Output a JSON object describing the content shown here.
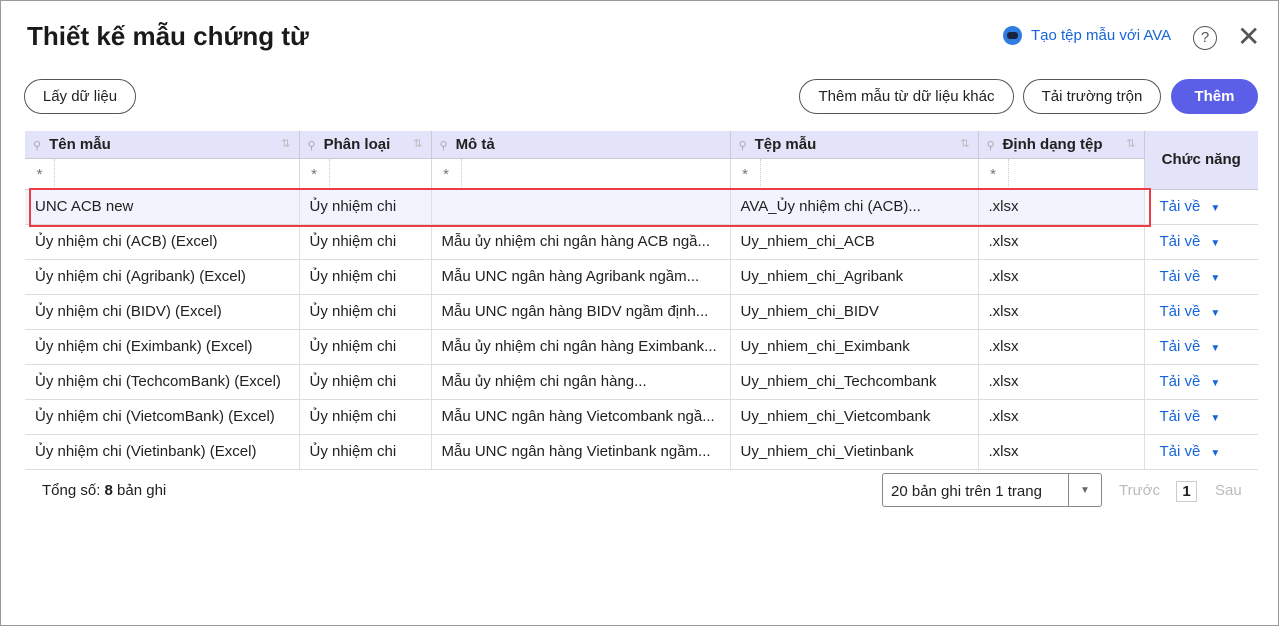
{
  "header": {
    "title": "Thiết kế mẫu chứng từ",
    "ava_link": "Tạo tệp mẫu với AVA",
    "help": "?",
    "close": "✕"
  },
  "toolbar": {
    "get_data": "Lấy dữ liệu",
    "add_from_other": "Thêm mẫu từ dữ liệu khác",
    "download_fields": "Tải trường trộn",
    "add": "Thêm"
  },
  "table": {
    "columns": [
      "Tên mẫu",
      "Phân loại",
      "Mô tả",
      "Tệp mẫu",
      "Định dạng tệp"
    ],
    "action_column": "Chức năng",
    "filter_symbol": "*",
    "action_label": "Tải về",
    "rows": [
      [
        "UNC ACB new",
        "Ủy nhiệm chi",
        "",
        "AVA_Ủy nhiệm chi (ACB)...",
        ".xlsx"
      ],
      [
        "Ủy nhiệm chi (ACB) (Excel)",
        "Ủy nhiệm chi",
        "Mẫu ủy nhiệm chi ngân hàng ACB ngầ...",
        "Uy_nhiem_chi_ACB",
        ".xlsx"
      ],
      [
        "Ủy nhiệm chi (Agribank) (Excel)",
        "Ủy nhiệm chi",
        "Mẫu UNC ngân hàng Agribank ngầm...",
        "Uy_nhiem_chi_Agribank",
        ".xlsx"
      ],
      [
        "Ủy nhiệm chi (BIDV) (Excel)",
        "Ủy nhiệm chi",
        "Mẫu UNC ngân hàng BIDV ngầm định...",
        "Uy_nhiem_chi_BIDV",
        ".xlsx"
      ],
      [
        "Ủy nhiệm chi (Eximbank) (Excel)",
        "Ủy nhiệm chi",
        "Mẫu ủy nhiệm chi ngân hàng Eximbank...",
        "Uy_nhiem_chi_Eximbank",
        ".xlsx"
      ],
      [
        "Ủy nhiệm chi (TechcomBank) (Excel)",
        "Ủy nhiệm chi",
        "Mẫu ủy nhiệm chi ngân hàng...",
        "Uy_nhiem_chi_Techcombank",
        ".xlsx"
      ],
      [
        "Ủy nhiệm chi (VietcomBank) (Excel)",
        "Ủy nhiệm chi",
        "Mẫu UNC ngân hàng Vietcombank ngầ...",
        "Uy_nhiem_chi_Vietcombank",
        ".xlsx"
      ],
      [
        "Ủy nhiệm chi (Vietinbank) (Excel)",
        "Ủy nhiệm chi",
        "Mẫu UNC ngân hàng Vietinbank ngầm...",
        "Uy_nhiem_chi_Vietinbank",
        ".xlsx"
      ]
    ]
  },
  "footer": {
    "total_prefix": "Tổng số: ",
    "total_count": "8",
    "total_suffix": " bản ghi",
    "page_size": "20 bản ghi trên 1 trang",
    "prev": "Trước",
    "page": "1",
    "next": "Sau"
  },
  "colors": {
    "primary": "#5b5fe8",
    "link": "#1565d8",
    "highlight": "#ef3b47"
  }
}
